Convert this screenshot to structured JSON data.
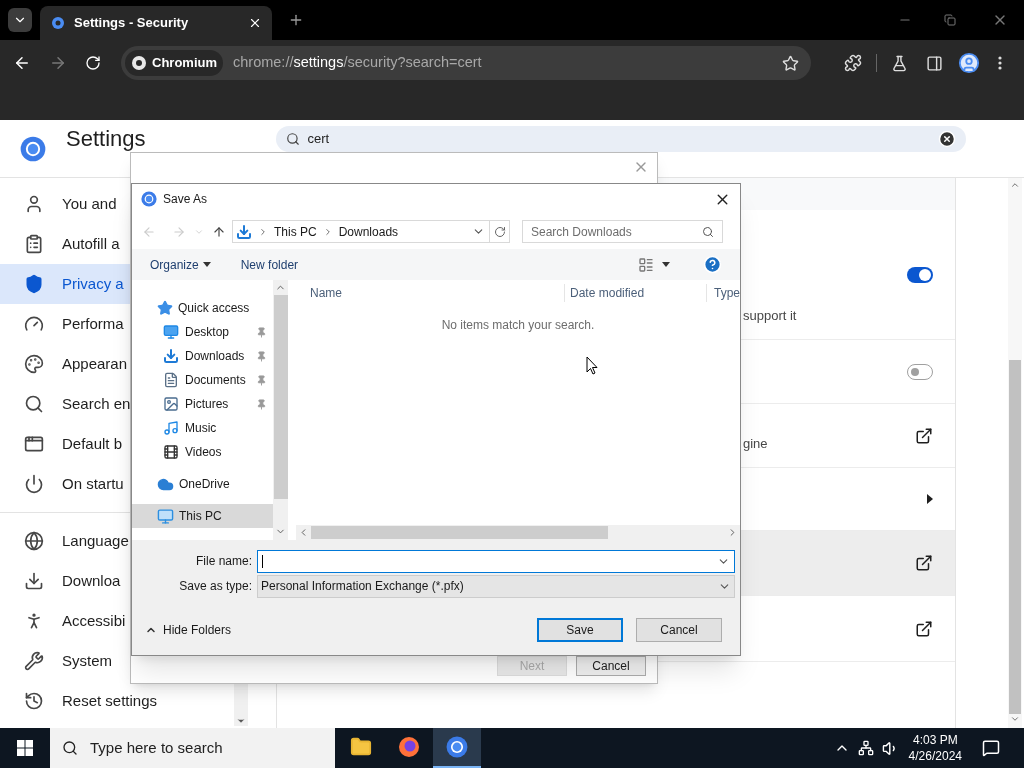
{
  "browser": {
    "tab": {
      "title": "Settings - Security",
      "selected": true
    },
    "nav": {
      "forward_disabled": true
    },
    "chip": "Chromium",
    "url": {
      "scheme": "chrome://",
      "host": "settings",
      "path": "/security?search=cert"
    }
  },
  "settings": {
    "title": "Settings",
    "search": {
      "value": "cert"
    },
    "sidebar": [
      {
        "label": "You and",
        "selected": false
      },
      {
        "label": "Autofill a",
        "selected": false
      },
      {
        "label": "Privacy a",
        "selected": true
      },
      {
        "label": "Performa",
        "selected": false
      },
      {
        "label": "Appearan",
        "selected": false
      },
      {
        "label": "Search en",
        "selected": false
      },
      {
        "label": "Default b",
        "selected": false
      },
      {
        "label": "On startu",
        "selected": false
      }
    ],
    "sidebar_more": [
      {
        "label": "Language",
        "selected": false
      },
      {
        "label": "Downloa",
        "selected": false
      },
      {
        "label": "Accessibi",
        "selected": false
      },
      {
        "label": "System",
        "selected": false
      },
      {
        "label": "Reset settings",
        "selected": false
      }
    ],
    "rows": [
      {
        "kind": "toggle",
        "text": "support it",
        "on": true,
        "hovered": false
      },
      {
        "kind": "toggle",
        "on": false,
        "hovered": false
      },
      {
        "kind": "link",
        "text": "gine",
        "hovered": false
      },
      {
        "kind": "submenu",
        "hovered": false
      },
      {
        "kind": "link",
        "hovered": true
      },
      {
        "kind": "link",
        "hovered": false
      }
    ]
  },
  "back_dialog": {
    "buttons": [
      {
        "label": "Next",
        "disabled": true
      },
      {
        "label": "Cancel",
        "disabled": false
      }
    ]
  },
  "save_as": {
    "title": "Save As",
    "nav": {
      "back_disabled": true,
      "forward_disabled": true
    },
    "path": [
      "This PC",
      "Downloads"
    ],
    "search": {
      "placeholder": "Search Downloads"
    },
    "toolbar": {
      "organize": "Organize",
      "new_folder": "New folder"
    },
    "tree": [
      {
        "label": "Quick access",
        "selected": false,
        "children": [
          {
            "label": "Desktop",
            "pinned": true,
            "selected": false
          },
          {
            "label": "Downloads",
            "pinned": true,
            "selected": false
          },
          {
            "label": "Documents",
            "pinned": true,
            "selected": false
          },
          {
            "label": "Pictures",
            "pinned": true,
            "selected": false
          },
          {
            "label": "Music",
            "pinned": false,
            "selected": false
          },
          {
            "label": "Videos",
            "pinned": false,
            "selected": false
          }
        ]
      },
      {
        "label": "OneDrive",
        "selected": false
      },
      {
        "label": "This PC",
        "selected": true
      }
    ],
    "columns": [
      "Name",
      "Date modified",
      "Type"
    ],
    "empty_message": "No items match your search.",
    "file_name": {
      "label": "File name:"
    },
    "save_type": {
      "label": "Save as type:",
      "value": "Personal Information Exchange (*.pfx)"
    },
    "hide_folders": "Hide Folders",
    "buttons": [
      {
        "label": "Save",
        "default": true
      },
      {
        "label": "Cancel",
        "default": false
      }
    ]
  },
  "taskbar": {
    "search": {
      "placeholder": "Type here to search"
    },
    "apps": [
      {
        "selected": false
      },
      {
        "selected": false
      },
      {
        "selected": true
      }
    ],
    "time": "4:03 PM",
    "date": "4/26/2024"
  }
}
